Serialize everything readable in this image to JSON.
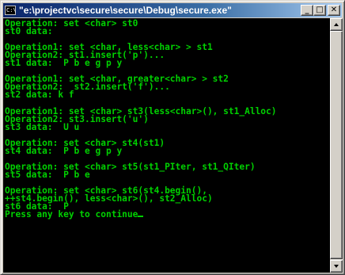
{
  "window": {
    "title": "\"e:\\projectvc\\secure\\secure\\Debug\\secure.exe\"",
    "icon_label": "C:\\",
    "minimize_label": "_",
    "maximize_label": "□",
    "close_label": "✕"
  },
  "colors": {
    "console_text": "#00d000",
    "console_background": "#000000",
    "title_bar": "#0a246a"
  },
  "icons": {
    "app": "console-icon",
    "minimize": "minimize-icon",
    "maximize": "maximize-icon",
    "close": "close-icon",
    "scroll_up": "scroll-up-arrow-icon",
    "scroll_down": "scroll-down-arrow-icon"
  },
  "console": {
    "lines": [
      "Operation: set <char> st0",
      "st0 data:",
      "",
      "Operation1: set <char, less<char> > st1",
      "Operation2: st1.insert('p')...",
      "st1 data:  P b e g p y",
      "",
      "Operation1: set <char, greater<char> > st2",
      "Operation2:  st2.insert('f')...",
      "st2 data: k f",
      "",
      "Operation1: set <char> st3(less<char>(), st1_Alloc)",
      "Operation2: st3.insert('u')",
      "st3 data:  U u",
      "",
      "Operation: set <char> st4(st1)",
      "st4 data:  P b e g p y",
      "",
      "Operation: set <char> st5(st1_PIter, st1_QIter)",
      "st5 data:  P b e",
      "",
      "Operation: set <char> st6(st4.begin(),",
      "++st4.begin(), less<char>(), st2_Alloc)",
      "st6 data:  P",
      "Press any key to continue"
    ]
  }
}
